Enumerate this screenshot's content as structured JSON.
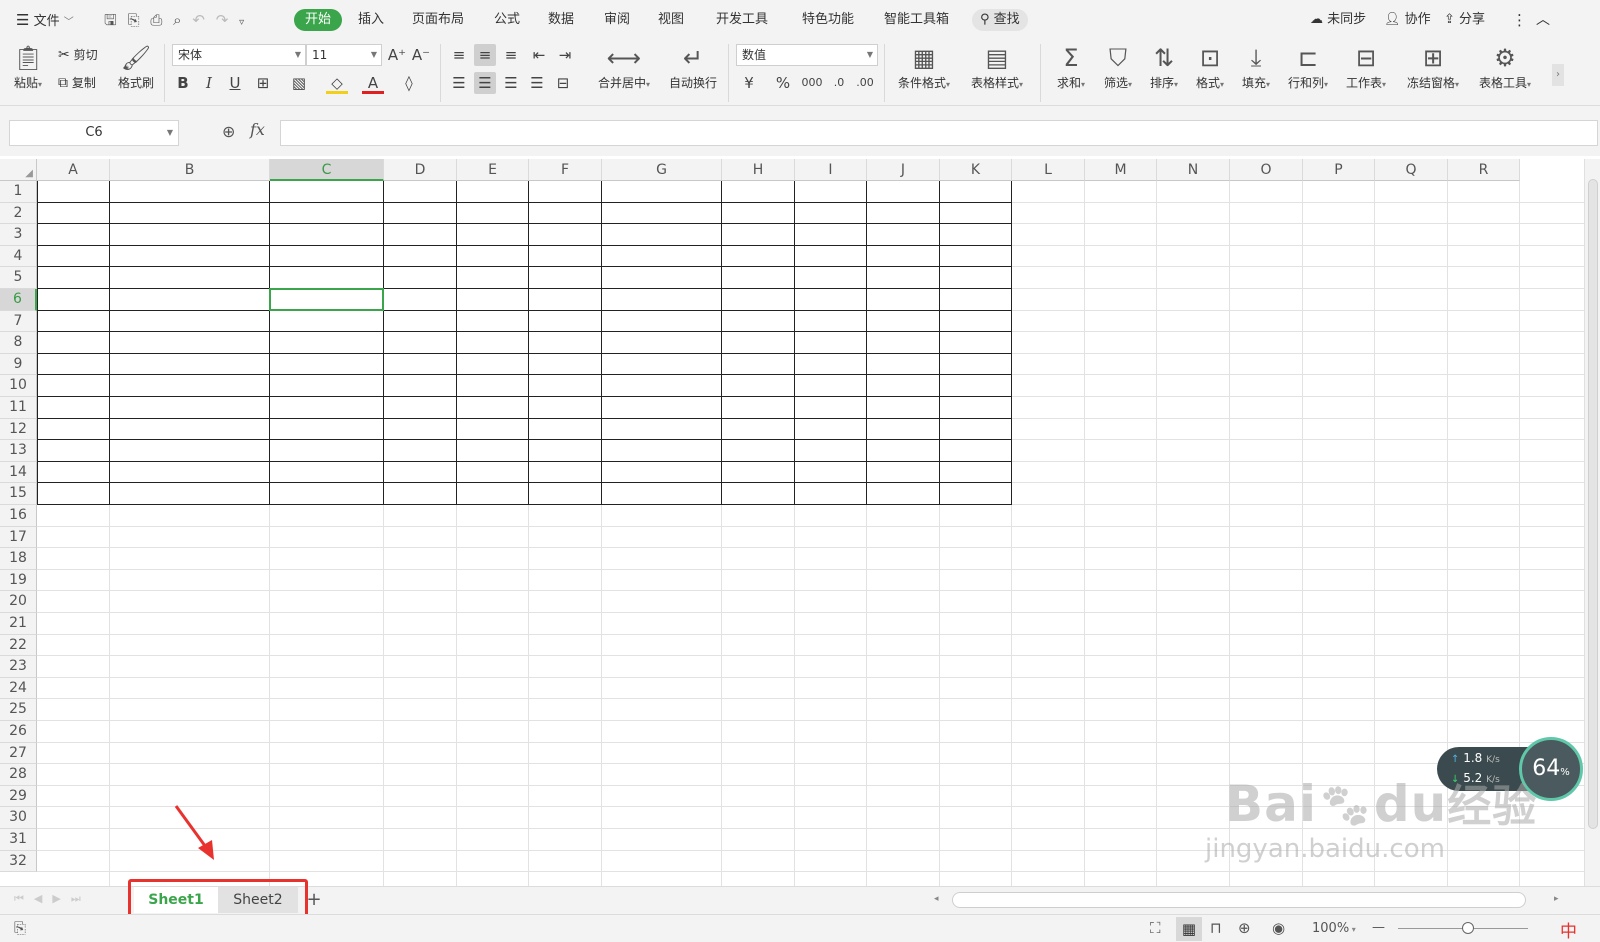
{
  "menubar": {
    "file_label": "文件",
    "tabs": [
      "开始",
      "插入",
      "页面布局",
      "公式",
      "数据",
      "审阅",
      "视图",
      "开发工具",
      "特色功能",
      "智能工具箱"
    ],
    "active_tab": "开始",
    "search_label": "查找",
    "sync_label": "未同步",
    "collab_label": "协作",
    "share_label": "分享"
  },
  "ribbon": {
    "paste_label": "粘贴",
    "cut_label": "剪切",
    "copy_label": "复制",
    "format_painter_label": "格式刷",
    "font_name": "宋体",
    "font_size": "11",
    "merge_center_label": "合并居中",
    "wrap_text_label": "自动换行",
    "number_format": "数值",
    "currency_symbol": "¥",
    "percent_symbol": "%",
    "thousands_symbol": "000",
    "conditional_format_label": "条件格式",
    "table_style_label": "表格样式",
    "sum_label": "求和",
    "filter_label": "筛选",
    "sort_label": "排序",
    "format_label": "格式",
    "fill_label": "填充",
    "row_col_label": "行和列",
    "worksheet_label": "工作表",
    "freeze_label": "冻结窗格",
    "table_tools_label": "表格工具"
  },
  "formula_bar": {
    "cell_reference": "C6",
    "fx_label": "fx",
    "formula_value": ""
  },
  "grid": {
    "columns": [
      "A",
      "B",
      "C",
      "D",
      "E",
      "F",
      "G",
      "H",
      "I",
      "J",
      "K",
      "L",
      "M",
      "N",
      "O",
      "P",
      "Q",
      "R"
    ],
    "rows": [
      "1",
      "2",
      "3",
      "4",
      "5",
      "6",
      "7",
      "8",
      "9",
      "10",
      "11",
      "12",
      "13",
      "14",
      "15",
      "16",
      "17",
      "18",
      "19",
      "20",
      "21",
      "22",
      "23",
      "24",
      "25",
      "26",
      "27",
      "28",
      "29",
      "30",
      "31",
      "32"
    ],
    "selected_column": "C",
    "selected_row": "6"
  },
  "sheets": {
    "tabs": [
      "Sheet1",
      "Sheet2"
    ],
    "active": "Sheet1",
    "add_label": "+"
  },
  "statusbar": {
    "zoom": "100%",
    "zoom_out": "—",
    "ime_label": "中"
  },
  "net_widget": {
    "upload": "1.8",
    "download": "5.2",
    "unit": "K/s",
    "percent": "64",
    "percent_sign": "%"
  },
  "watermark": {
    "brand": "Bai",
    "brand2": "du",
    "suffix": "经验",
    "url": "jingyan.baidu.com"
  },
  "colors": {
    "accent": "#3aa54b",
    "highlight": "#e8322e"
  }
}
